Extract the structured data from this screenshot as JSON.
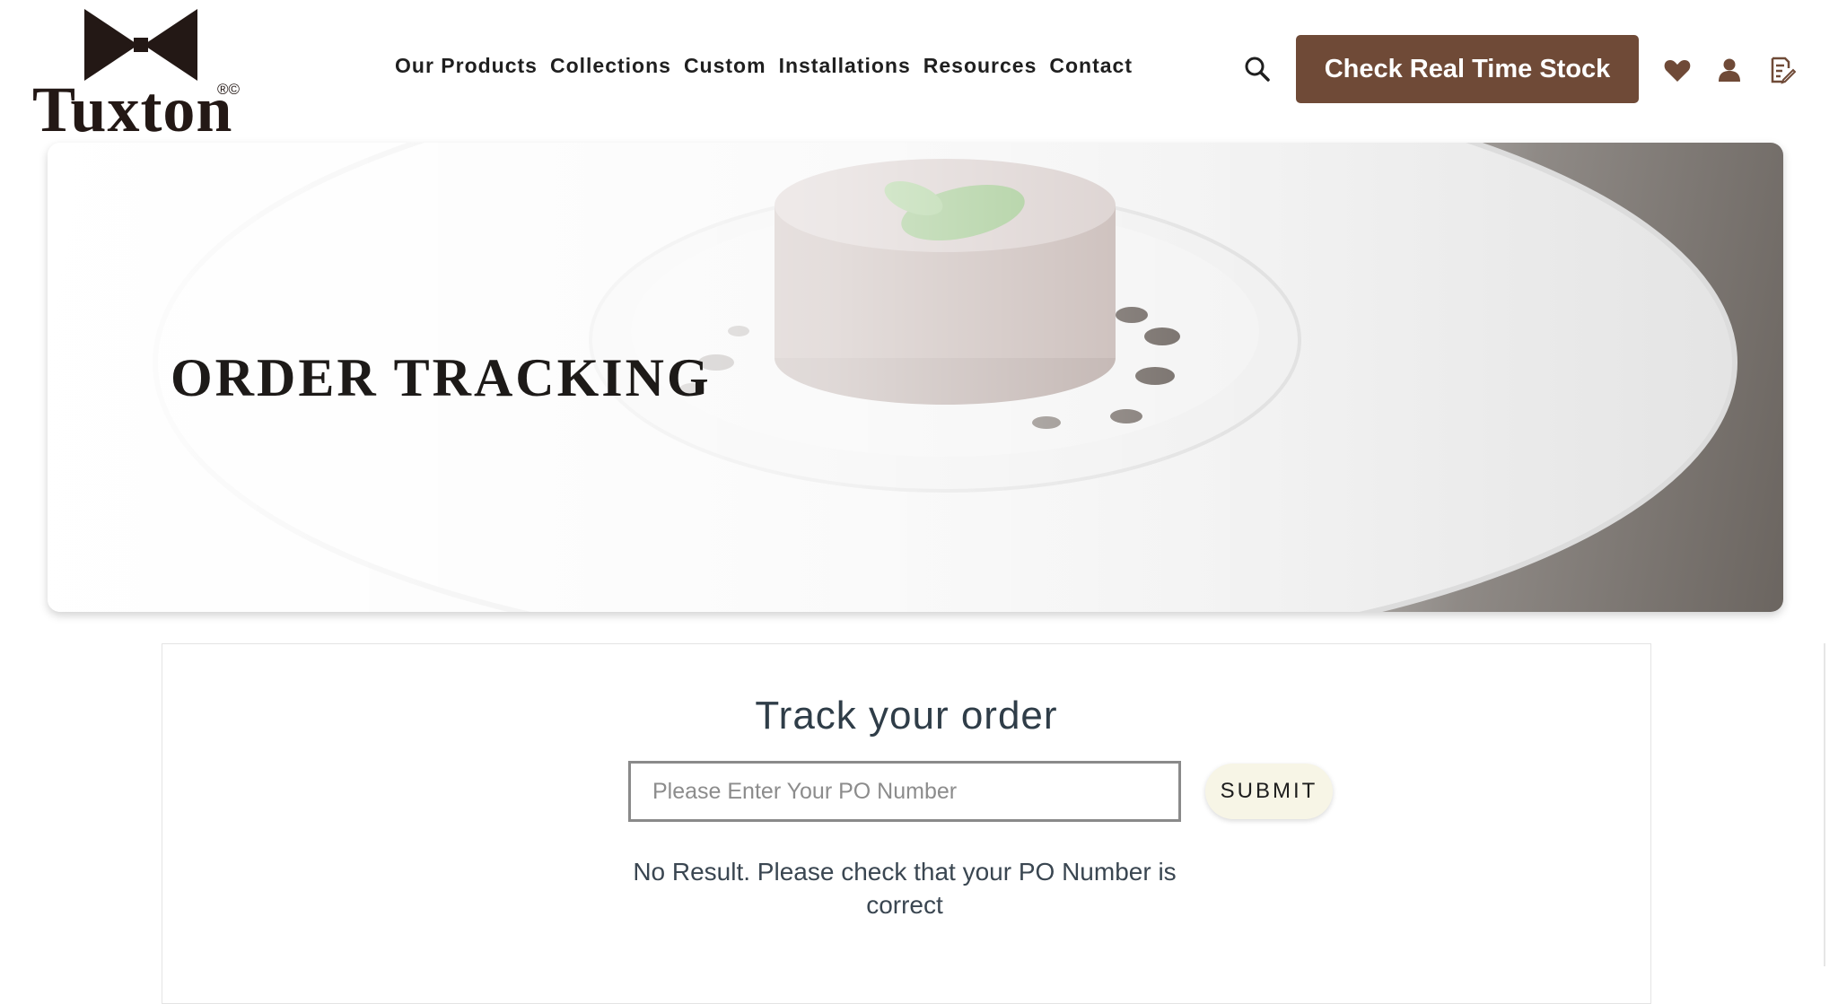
{
  "brand": {
    "name": "Tuxton",
    "mark": "®©"
  },
  "nav": {
    "items": [
      {
        "label": "Our Products"
      },
      {
        "label": "Collections"
      },
      {
        "label": "Custom"
      },
      {
        "label": "Installations"
      },
      {
        "label": "Resources"
      },
      {
        "label": "Contact"
      }
    ]
  },
  "header": {
    "stock_button": "Check Real Time Stock",
    "icons": [
      "search-icon",
      "heart-icon",
      "user-icon",
      "quote-list-icon"
    ]
  },
  "hero": {
    "title": "ORDER TRACKING"
  },
  "tracker": {
    "title": "Track your order",
    "placeholder": "Please Enter Your PO Number",
    "value": "",
    "submit_label": "SUBMIT",
    "result_message": "No Result. Please check that your PO Number is correct"
  },
  "colors": {
    "accent": "#6f4a37",
    "text_dark": "#231815",
    "heading": "#2f3d48",
    "submit_bg": "#f7f5e6"
  }
}
